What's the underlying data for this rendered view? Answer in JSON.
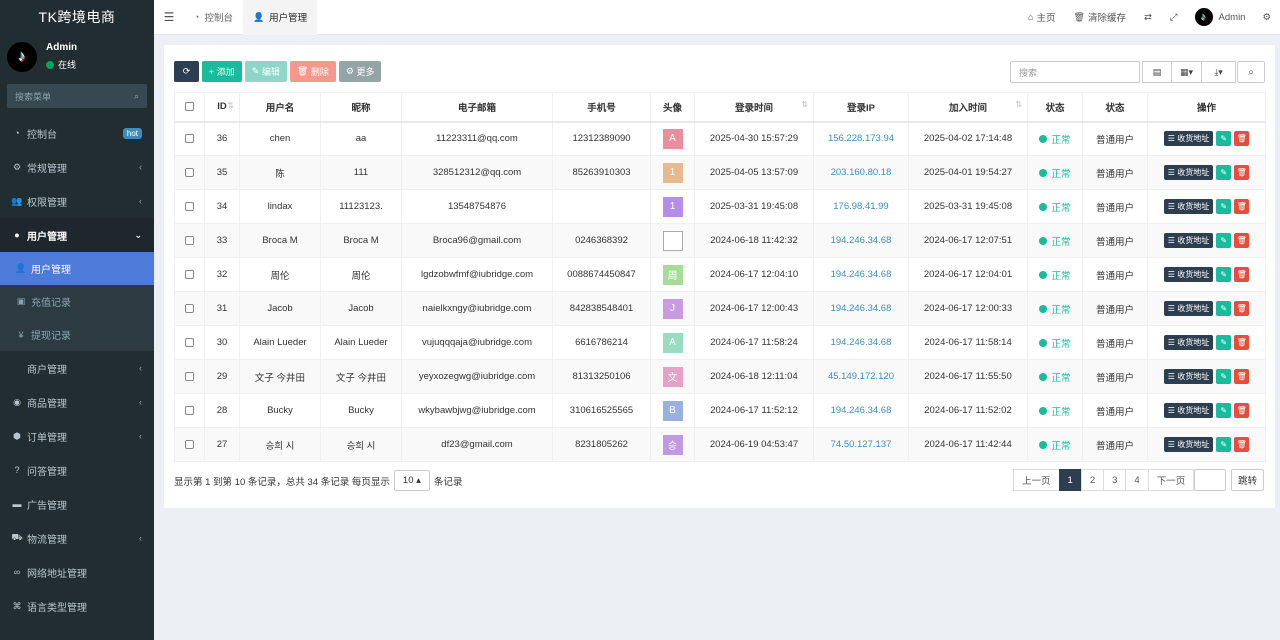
{
  "sidebar": {
    "brand": "TK跨境电商",
    "user": {
      "name": "Admin",
      "status": "在线"
    },
    "search_placeholder": "搜索菜单",
    "menu": [
      {
        "label": "控制台",
        "icon": "dashboard-icon",
        "badge": "hot"
      },
      {
        "label": "常规管理",
        "icon": "cogs-icon"
      },
      {
        "label": "权限管理",
        "icon": "group-icon"
      },
      {
        "label": "用户管理",
        "icon": "user-circle-icon"
      }
    ],
    "submenu": [
      {
        "label": "用户管理",
        "icon": "user-icon"
      },
      {
        "label": "充值记录",
        "icon": "money-icon"
      },
      {
        "label": "提现记录",
        "icon": "yen-icon"
      }
    ],
    "menu2": [
      {
        "label": "商户管理",
        "icon": "apple-icon"
      },
      {
        "label": "商品管理",
        "icon": "product-icon"
      },
      {
        "label": "订单管理",
        "icon": "cube-icon"
      },
      {
        "label": "问答管理",
        "icon": "question-icon"
      },
      {
        "label": "广告管理",
        "icon": "ad-icon"
      },
      {
        "label": "物流管理",
        "icon": "truck-icon"
      },
      {
        "label": "网络地址管理",
        "icon": "link-icon"
      },
      {
        "label": "语言类型管理",
        "icon": "language-icon"
      }
    ]
  },
  "topbar": {
    "tabs": [
      {
        "label": "控制台",
        "icon": "dashboard-icon"
      },
      {
        "label": "用户管理",
        "icon": "user-icon"
      }
    ],
    "home": "主页",
    "clear_cache": "清除缓存",
    "admin": "Admin"
  },
  "toolbar": {
    "add": "添加",
    "edit": "编辑",
    "delete": "删除",
    "more": "更多",
    "search_placeholder": "搜索"
  },
  "table": {
    "headers": [
      "ID",
      "用户名",
      "昵称",
      "电子邮箱",
      "手机号",
      "头像",
      "登录时间",
      "登录IP",
      "加入时间",
      "状态",
      "状态",
      "操作"
    ],
    "op_addr_label": "收货地址",
    "rows": [
      {
        "id": "36",
        "username": "chen",
        "nickname": "aa",
        "email": "11223311@qq.com",
        "phone": "12312389090",
        "avatar": "A",
        "avatar_color": "#e88e9d",
        "login_time": "2025-04-30 15:57:29",
        "ip": "156.228.173.94",
        "join_time": "2025-04-02 17:14:48",
        "status": "正常",
        "role": "普通用户"
      },
      {
        "id": "35",
        "username": "陈",
        "nickname": "111",
        "email": "328512312@qq.com",
        "phone": "85263910303",
        "avatar": "1",
        "avatar_color": "#e8b98e",
        "login_time": "2025-04-05 13:57:09",
        "ip": "203.160.80.18",
        "join_time": "2025-04-01 19:54:27",
        "status": "正常",
        "role": "普通用户"
      },
      {
        "id": "34",
        "username": "lindax",
        "nickname": "11123123.",
        "email": "13548754876",
        "phone": "",
        "avatar": "1",
        "avatar_color": "#b48ee8",
        "login_time": "2025-03-31 19:45:08",
        "ip": "176.98.41.99",
        "join_time": "2025-03-31 19:45:08",
        "status": "正常",
        "role": "普通用户"
      },
      {
        "id": "33",
        "username": "Broca M",
        "nickname": "Broca M",
        "email": "Broca96@gmail.com",
        "phone": "0246368392",
        "avatar": "",
        "avatar_color": "broken",
        "login_time": "2024-06-18 11:42:32",
        "ip": "194.246.34.68",
        "join_time": "2024-06-17 12:07:51",
        "status": "正常",
        "role": "普通用户"
      },
      {
        "id": "32",
        "username": "周伦",
        "nickname": "周伦",
        "email": "lgdzobwfmf@iubridge.com",
        "phone": "0088674450847",
        "avatar": "周",
        "avatar_color": "#a6dc9a",
        "login_time": "2024-06-17 12:04:10",
        "ip": "194.246.34.68",
        "join_time": "2024-06-17 12:04:01",
        "status": "正常",
        "role": "普通用户"
      },
      {
        "id": "31",
        "username": "Jacob",
        "nickname": "Jacob",
        "email": "naielkxngy@iubridge.com",
        "phone": "842838548401",
        "avatar": "J",
        "avatar_color": "#c99ae0",
        "login_time": "2024-06-17 12:00:43",
        "ip": "194.246.34.68",
        "join_time": "2024-06-17 12:00:33",
        "status": "正常",
        "role": "普通用户"
      },
      {
        "id": "30",
        "username": "Alain Lueder",
        "nickname": "Alain Lueder",
        "email": "vujuqqqaja@iubridge.com",
        "phone": "6616786214",
        "avatar": "A",
        "avatar_color": "#9adcc1",
        "login_time": "2024-06-17 11:58:24",
        "ip": "194.246.34.68",
        "join_time": "2024-06-17 11:58:14",
        "status": "正常",
        "role": "普通用户"
      },
      {
        "id": "29",
        "username": "文子 今井田",
        "nickname": "文子 今井田",
        "email": "yeyxozegwg@iubridge.com",
        "phone": "81313250106",
        "avatar": "文",
        "avatar_color": "#e8a0c8",
        "login_time": "2024-06-18 12:11:04",
        "ip": "45.149.172.120",
        "join_time": "2024-06-17 11:55:50",
        "status": "正常",
        "role": "普通用户"
      },
      {
        "id": "28",
        "username": "Bucky",
        "nickname": "Bucky",
        "email": "wkybawbjwg@iubridge.com",
        "phone": "310616525565",
        "avatar": "B",
        "avatar_color": "#9ab0e0",
        "login_time": "2024-06-17 11:52:12",
        "ip": "194.246.34.68",
        "join_time": "2024-06-17 11:52:02",
        "status": "正常",
        "role": "普通用户"
      },
      {
        "id": "27",
        "username": "승희 시",
        "nickname": "승희 시",
        "email": "df23@gmail.com",
        "phone": "8231805262",
        "avatar": "승",
        "avatar_color": "#c09ae0",
        "login_time": "2024-06-19 04:53:47",
        "ip": "74.50.127.137",
        "join_time": "2024-06-17 11:42:44",
        "status": "正常",
        "role": "普通用户"
      }
    ]
  },
  "footer": {
    "info_prefix": "显示第 1 到第 10 条记录，总共 34 条记录 每页显示",
    "page_size": "10",
    "info_suffix": "条记录",
    "prev": "上一页",
    "pages": [
      "1",
      "2",
      "3",
      "4"
    ],
    "next": "下一页",
    "jump": "跳转"
  }
}
